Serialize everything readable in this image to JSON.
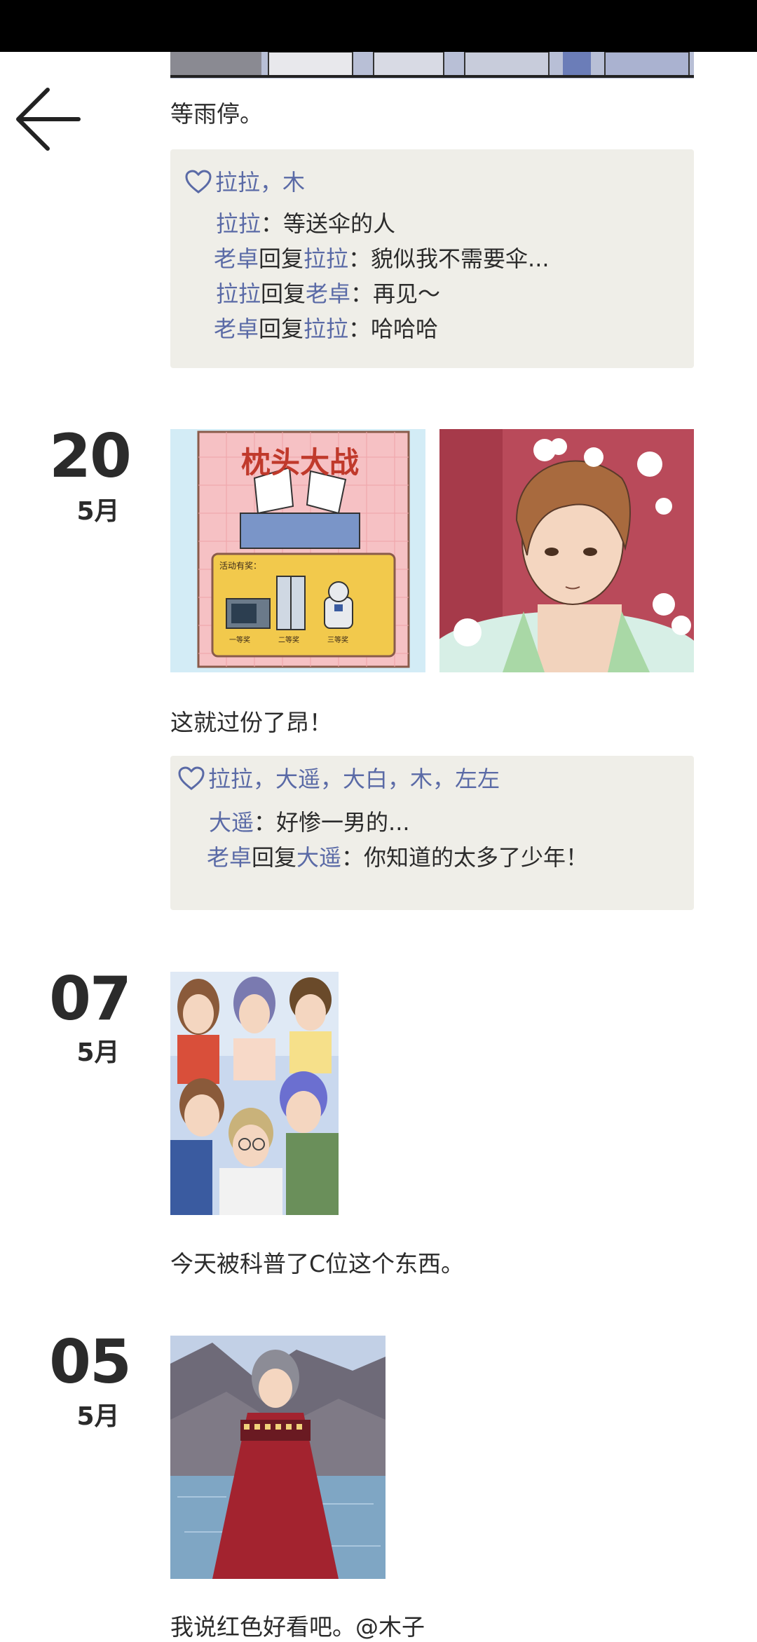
{
  "posts": [
    {
      "text": "等雨停。",
      "likes": "拉拉，木",
      "comments": [
        {
          "user": "拉拉",
          "reply_word": "",
          "target": "",
          "text": "：等送伞的人"
        },
        {
          "user": "老卓",
          "reply_word": "回复",
          "target": "拉拉",
          "text": "：貌似我不需要伞..."
        },
        {
          "user": "拉拉",
          "reply_word": "回复",
          "target": "老卓",
          "text": "：再见～"
        },
        {
          "user": "老卓",
          "reply_word": "回复",
          "target": "拉拉",
          "text": "：哈哈哈"
        }
      ]
    },
    {
      "day": "20",
      "month": "5月",
      "poster": {
        "title": "枕头大战",
        "subtitle": "活动有奖：",
        "prizes": [
          "一等奖",
          "二等奖",
          "三等奖"
        ]
      },
      "text": "这就过份了昂！",
      "likes": "拉拉，大遥，大白，木，左左",
      "comments": [
        {
          "user": "大遥",
          "reply_word": "",
          "target": "",
          "text": "：好惨一男的..."
        },
        {
          "user": "老卓",
          "reply_word": "回复",
          "target": "大遥",
          "text": "：你知道的太多了少年！"
        }
      ]
    },
    {
      "day": "07",
      "month": "5月",
      "text": "今天被科普了C位这个东西。"
    },
    {
      "day": "05",
      "month": "5月",
      "text": "我说红色好看吧。@木子"
    }
  ],
  "colors": {
    "name": "#5a6aa6",
    "comment_bg": "#efeee8",
    "text": "#2b2b2b"
  },
  "icons": {
    "back": "arrow-left-icon",
    "like": "heart-outline-icon"
  }
}
